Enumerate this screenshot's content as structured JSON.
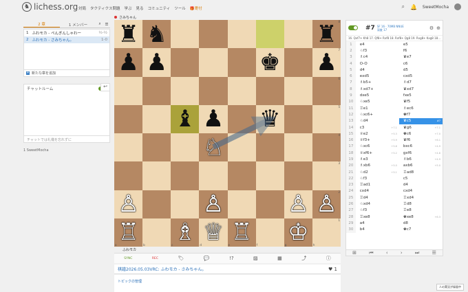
{
  "header": {
    "logo_text": "lichess.org",
    "nav": [
      "対局",
      "タクティクス問題",
      "学ぶ",
      "見る",
      "コミュニティ",
      "ツール",
      "🎁寄付"
    ],
    "username": "SweetMocha"
  },
  "left": {
    "tab_chapters": "2 章",
    "tab_members": "1 メンバー",
    "chapters": [
      {
        "num": "1",
        "title": "ふわモカ - ぺんぎんしゃわー",
        "score": "½-½"
      },
      {
        "num": "2",
        "title": "ふわモカ - さみちゃん。",
        "score": "1-0"
      }
    ],
    "new_chapter": "新たな章を追加",
    "chat_title": "チャットルーム",
    "chat_placeholder": "チャットでは礼儀を忘れずに",
    "members_line": "1 SweetMocha"
  },
  "board": {
    "top_player": "さみちゃん",
    "bottom_player": "ふわモカ",
    "ranks": [
      "8",
      "7",
      "6",
      "5",
      "4",
      "3",
      "2",
      "1"
    ],
    "files": [
      "a",
      "b",
      "c",
      "d",
      "e",
      "f",
      "g",
      "h"
    ],
    "pieces": [
      [
        "♜",
        "♞",
        "",
        "",
        "",
        "",
        "",
        "♜"
      ],
      [
        "♟",
        "♟",
        "",
        "",
        "",
        "♚",
        "",
        "♟"
      ],
      [
        "",
        "",
        "",
        "",
        "",
        "",
        "",
        ""
      ],
      [
        "",
        "",
        "♝",
        "♟",
        "",
        "♛",
        "",
        ""
      ],
      [
        "",
        "",
        "",
        "♘",
        "",
        "",
        "",
        ""
      ],
      [
        "",
        "",
        "",
        "",
        "",
        "",
        "",
        ""
      ],
      [
        "♙",
        "",
        "",
        "♙",
        "",
        "",
        "♙",
        "♙"
      ],
      [
        "♖",
        "",
        "♗",
        "♕",
        "♖",
        "",
        "♔",
        ""
      ]
    ],
    "colors": [
      [
        "b",
        "b",
        "",
        "",
        "",
        "",
        "",
        "b"
      ],
      [
        "b",
        "b",
        "",
        "",
        "",
        "b",
        "",
        "b"
      ],
      [
        "",
        "",
        "",
        "",
        "",
        "",
        "",
        ""
      ],
      [
        "",
        "",
        "b",
        "b",
        "",
        "b",
        "",
        ""
      ],
      [
        "",
        "",
        "",
        "w",
        "",
        "",
        "",
        ""
      ],
      [
        "",
        "",
        "",
        "",
        "",
        "",
        "",
        ""
      ],
      [
        "w",
        "",
        "",
        "w",
        "",
        "",
        "w",
        "w"
      ],
      [
        "w",
        "",
        "w",
        "w",
        "w",
        "",
        "w",
        ""
      ]
    ]
  },
  "underbar": {
    "sync": "SYNC",
    "rec": "REC",
    "title": "棋譜2026.05.03VRC: ふわモカ - さみちゃん。",
    "heart_count": "1",
    "topic": "トピックの管理"
  },
  "right": {
    "engine_depth": "#7",
    "engine_info": "SF 16 · 70MB NNUE",
    "engine_mode": "深度 17",
    "pv": "16. Qxf7+ Kh8 17. Qf8+ Rxf8 18. Rxf8+ Qg8 19. Rxg8+ Kxg8 18...",
    "moves": [
      {
        "n": "1",
        "w": "e4",
        "we": "",
        "b": "e5",
        "be": ""
      },
      {
        "n": "2",
        "w": "♘f3",
        "we": "",
        "b": "f6",
        "be": ""
      },
      {
        "n": "3",
        "w": "♗c4",
        "we": "",
        "b": "♛e7",
        "be": ""
      },
      {
        "n": "4",
        "w": "O-O",
        "we": "",
        "b": "c6",
        "be": ""
      },
      {
        "n": "5",
        "w": "d4",
        "we": "",
        "b": "d5",
        "be": ""
      },
      {
        "n": "6",
        "w": "exd5",
        "we": "",
        "b": "cxd5",
        "be": ""
      },
      {
        "n": "7",
        "w": "♗b5+",
        "we": "",
        "b": "♗d7",
        "be": ""
      },
      {
        "n": "8",
        "w": "♗xd7+",
        "we": "",
        "b": "♛xd7",
        "be": ""
      },
      {
        "n": "9",
        "w": "dxe5",
        "we": "",
        "b": "fxe5",
        "be": ""
      },
      {
        "n": "10",
        "w": "♘xe5",
        "we": "",
        "b": "♛f5",
        "be": ""
      },
      {
        "n": "11",
        "w": "♖e1",
        "we": "",
        "b": "♗ec6",
        "be": ""
      },
      {
        "n": "12",
        "w": "♘xc6+",
        "we": "",
        "b": "♚f7",
        "be": ""
      },
      {
        "n": "13",
        "w": "♘d4",
        "we": "",
        "b": "♛c5",
        "be": "#7"
      },
      {
        "n": "14",
        "w": "c3",
        "we": "+7.1",
        "b": "♛g6",
        "be": "+7.1"
      },
      {
        "n": "15",
        "w": "♕e2",
        "we": "+5.3",
        "b": "♚c6",
        "be": "+7.0"
      },
      {
        "n": "16",
        "w": "♕f3+",
        "we": "+5.9",
        "b": "♛f6",
        "be": "+6.1"
      },
      {
        "n": "17",
        "w": "♘xc6",
        "we": "+5.8",
        "b": "bxc6",
        "be": "+4.9"
      },
      {
        "n": "18",
        "w": "♕xf6+",
        "we": "+5.2",
        "b": "gxf6",
        "be": "+4.8"
      },
      {
        "n": "19",
        "w": "♗e3",
        "we": "",
        "b": "♗b6",
        "be": "+4.9"
      },
      {
        "n": "20",
        "w": "♗xb6",
        "we": "+5.0",
        "b": "axb6",
        "be": "+5.0"
      },
      {
        "n": "21",
        "w": "♘d2",
        "we": "+5.1",
        "b": "♖ad8",
        "be": ""
      },
      {
        "n": "22",
        "w": "♘f3",
        "we": "",
        "b": "c5",
        "be": ""
      },
      {
        "n": "23",
        "w": "♖ad1",
        "we": "",
        "b": "d4",
        "be": ""
      },
      {
        "n": "24",
        "w": "cxd4",
        "we": "",
        "b": "cxd4",
        "be": ""
      },
      {
        "n": "25",
        "w": "♖d4",
        "we": "",
        "b": "♖xd4",
        "be": ""
      },
      {
        "n": "26",
        "w": "♘xd4",
        "we": "",
        "b": "♖d8",
        "be": ""
      },
      {
        "n": "27",
        "w": "♘f3",
        "we": "",
        "b": "♖e8",
        "be": ""
      },
      {
        "n": "28",
        "w": "♖xe8",
        "we": "",
        "b": "♚xe8",
        "be": "+6.3"
      },
      {
        "n": "29",
        "w": "a4",
        "we": "",
        "b": "d8",
        "be": ""
      },
      {
        "n": "30",
        "w": "b4",
        "we": "",
        "b": "♚c7",
        "be": ""
      }
    ],
    "active_index": 12
  },
  "notice": "人の実況が録画中"
}
